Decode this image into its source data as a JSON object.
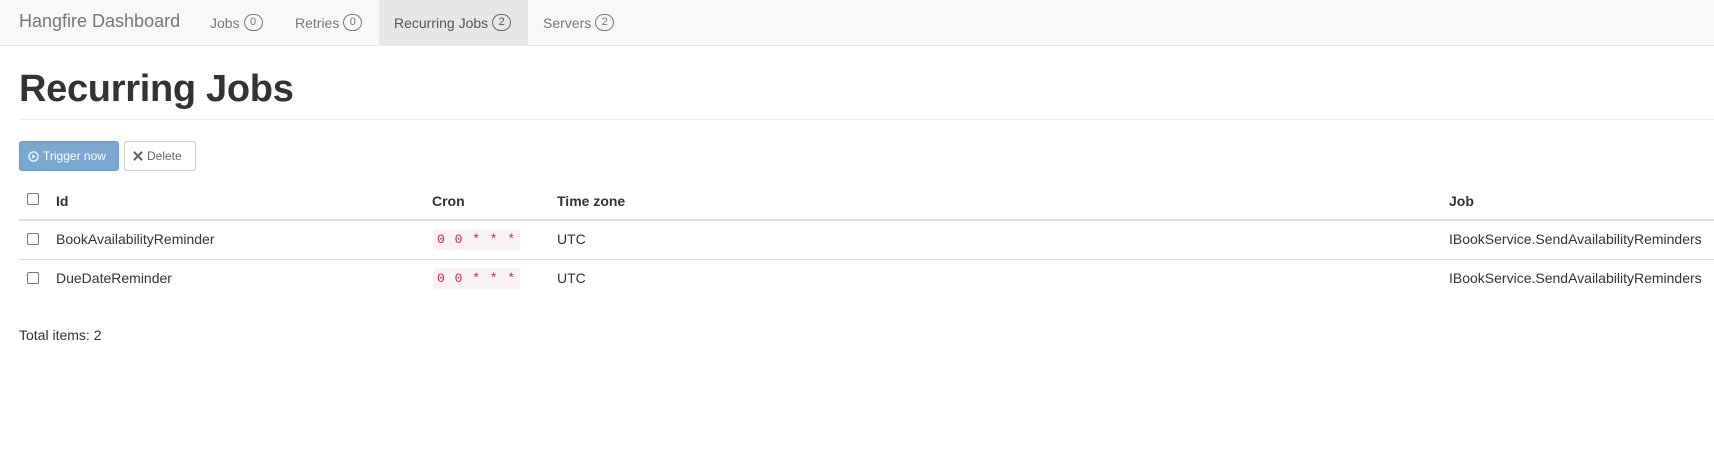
{
  "navbar": {
    "brand": "Hangfire Dashboard",
    "items": [
      {
        "label": "Jobs",
        "count": "0",
        "active": false
      },
      {
        "label": "Retries",
        "count": "0",
        "active": false
      },
      {
        "label": "Recurring Jobs",
        "count": "2",
        "active": true
      },
      {
        "label": "Servers",
        "count": "2",
        "active": false
      }
    ]
  },
  "page": {
    "title": "Recurring Jobs"
  },
  "toolbar": {
    "trigger_label": "Trigger now",
    "trigger_icon": "play-circle-icon",
    "delete_label": "Delete",
    "delete_icon": "close-icon"
  },
  "table": {
    "headers": {
      "id": "Id",
      "cron": "Cron",
      "timezone": "Time zone",
      "job": "Job"
    },
    "rows": [
      {
        "id": "BookAvailabilityReminder",
        "cron": "0 0 * * *",
        "timezone": "UTC",
        "job": "IBookService.SendAvailabilityReminders"
      },
      {
        "id": "DueDateReminder",
        "cron": "0 0 * * *",
        "timezone": "UTC",
        "job": "IBookService.SendAvailabilityReminders"
      }
    ]
  },
  "footer": {
    "total": "Total items: 2"
  },
  "colors": {
    "primary_button": "#7aa8d0",
    "cron_text": "#c7254e",
    "cron_bg": "#f9f2f4",
    "navbar_bg": "#f8f8f8",
    "active_tab_bg": "#e7e7e7"
  }
}
